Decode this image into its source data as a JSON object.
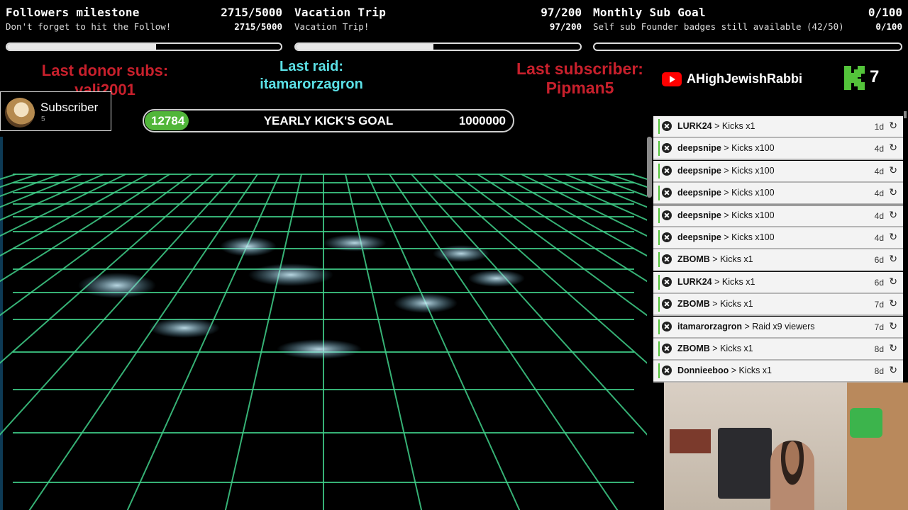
{
  "goals": [
    {
      "title": "Followers milestone",
      "count": "2715/5000",
      "subtitle": "Don't forget to hit the Follow!",
      "sub_count": "2715/5000",
      "progress": 0.543
    },
    {
      "title": "Vacation Trip",
      "count": "97/200",
      "subtitle": "Vacation Trip!",
      "sub_count": "97/200",
      "progress": 0.485
    },
    {
      "title": "Monthly Sub Goal",
      "count": "0/100",
      "subtitle": "Self sub Founder badges still available (42/50)",
      "sub_count": "0/100",
      "progress": 0.0
    }
  ],
  "last_donor": {
    "label": "Last donor subs:",
    "value": "vali2001"
  },
  "last_raid": {
    "label": "Last raid:",
    "value": "itamarorzagron"
  },
  "last_subscriber": {
    "label": "Last subscriber:",
    "value": "Pipman5"
  },
  "youtube_channel": "AHighJewishRabbi",
  "kick_count": "7",
  "subscriber_card": {
    "title": "Subscriber",
    "count": "5"
  },
  "kick_goal": {
    "current": "12784",
    "label": "YEARLY KICK'S GOAL",
    "target": "1000000",
    "progress": 0.0128
  },
  "events": [
    {
      "user": "LURK24",
      "action": "Kicks x1",
      "age": "1d",
      "icon": "kick-icon"
    },
    {
      "user": "deepsnipe",
      "action": "Kicks x100",
      "age": "4d",
      "icon": "kick-icon"
    },
    {
      "user": "deepsnipe",
      "action": "Kicks x100",
      "age": "4d",
      "icon": "kick-icon"
    },
    {
      "user": "deepsnipe",
      "action": "Kicks x100",
      "age": "4d",
      "icon": "kick-icon"
    },
    {
      "user": "deepsnipe",
      "action": "Kicks x100",
      "age": "4d",
      "icon": "kick-icon"
    },
    {
      "user": "deepsnipe",
      "action": "Kicks x100",
      "age": "4d",
      "icon": "kick-icon"
    },
    {
      "user": "ZBOMB",
      "action": "Kicks x1",
      "age": "6d",
      "icon": "kick-icon"
    },
    {
      "user": "LURK24",
      "action": "Kicks x1",
      "age": "6d",
      "icon": "kick-icon"
    },
    {
      "user": "ZBOMB",
      "action": "Kicks x1",
      "age": "7d",
      "icon": "kick-icon"
    },
    {
      "user": "itamarorzagron",
      "action": "Raid x9 viewers",
      "age": "7d",
      "icon": "raid-icon"
    },
    {
      "user": "ZBOMB",
      "action": "Kicks x1",
      "age": "8d",
      "icon": "kick-icon"
    },
    {
      "user": "Donnieeboo",
      "action": "Kicks x1",
      "age": "8d",
      "icon": "kick-icon"
    }
  ],
  "colors": {
    "accent_green": "#53c43a",
    "red_label": "#c8202c",
    "cyan_label": "#5be0e6",
    "grid_green": "#3fd08a"
  }
}
